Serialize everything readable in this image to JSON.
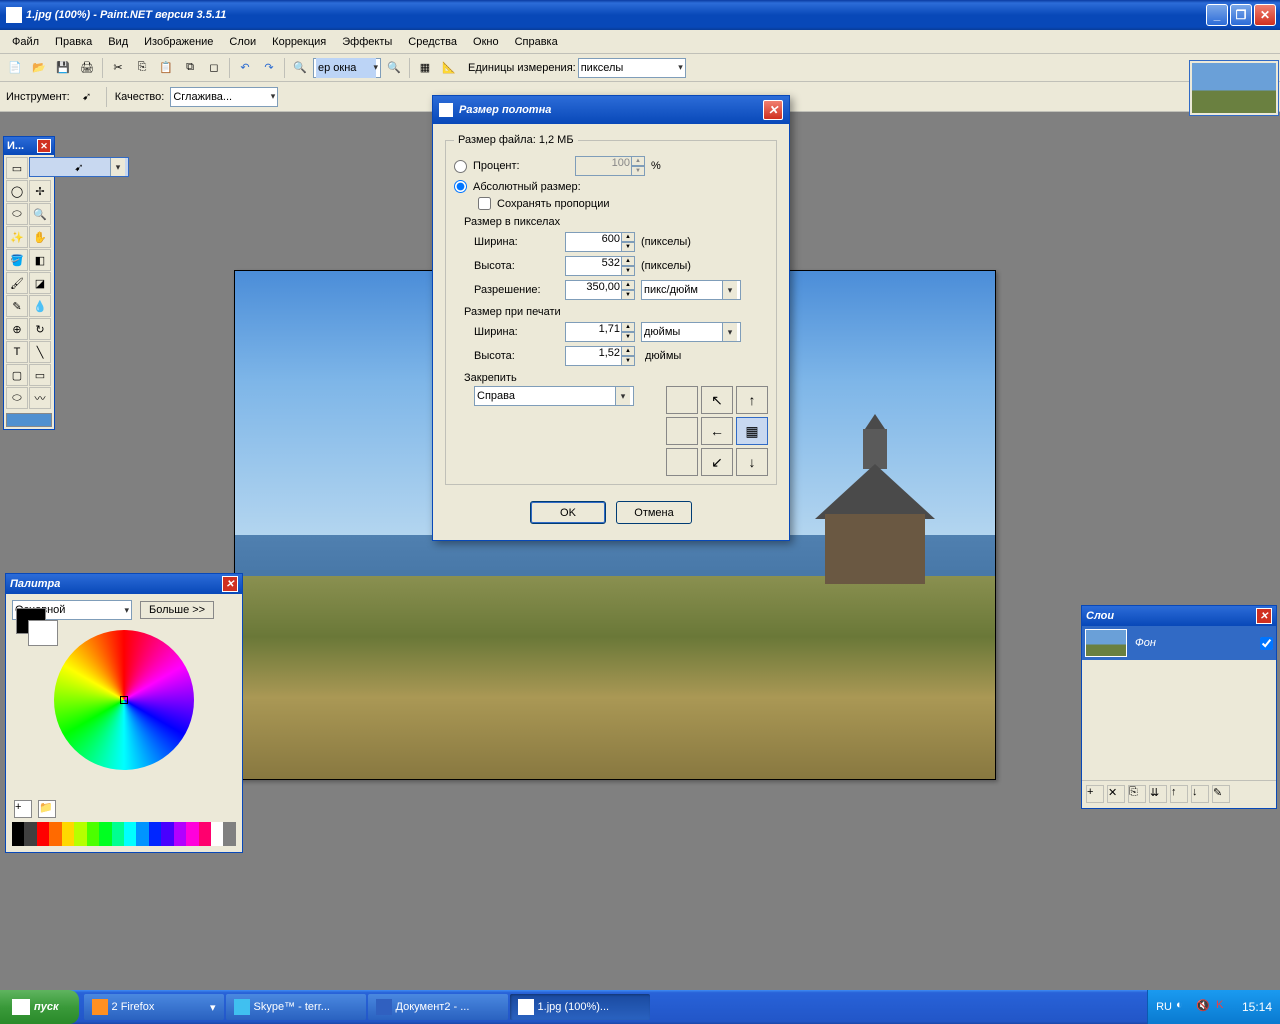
{
  "window": {
    "title": "1.jpg (100%) - Paint.NET версия 3.5.11"
  },
  "menu": {
    "file": "Файл",
    "edit": "Правка",
    "view": "Вид",
    "image": "Изображение",
    "layers": "Слои",
    "adjust": "Коррекция",
    "effects": "Эффекты",
    "tools": "Средства",
    "window": "Окно",
    "help": "Справка"
  },
  "toolbar": {
    "zoom": "ер окна",
    "units_label": "Единицы измерения:",
    "units": "пикселы"
  },
  "toolopts": {
    "instrument": "Инструмент:",
    "quality": "Качество:",
    "aa": "Сглажива..."
  },
  "toolpal": {
    "title": "И..."
  },
  "colorpal": {
    "title": "Палитра",
    "primary": "Основной",
    "more": "Больше >>",
    "colors": [
      "#000000",
      "#404040",
      "#ff0000",
      "#ff6a00",
      "#ffd800",
      "#b6ff00",
      "#4cff00",
      "#00ff21",
      "#00ff90",
      "#00ffff",
      "#0094ff",
      "#0026ff",
      "#4800ff",
      "#b200ff",
      "#ff00dc",
      "#ff006e",
      "#ffffff",
      "#808080"
    ]
  },
  "layers": {
    "title": "Слои",
    "bg": "Фон"
  },
  "dialog": {
    "title": "Размер полотна",
    "filesize_label": "Размер файла: 1,2 МБ",
    "percent": "Процент:",
    "percent_val": "100",
    "pct": "%",
    "absolute": "Абсолютный размер:",
    "keep": "Сохранять пропорции",
    "pxsize": "Размер в пикселах",
    "width": "Ширина:",
    "width_val": "600",
    "px_u": "(пикселы)",
    "height": "Высота:",
    "height_val": "532",
    "res": "Разрешение:",
    "res_val": "350,00",
    "res_u": "пикс/дюйм",
    "printsize": "Размер при печати",
    "pwidth_val": "1,71",
    "pheight_val": "1,52",
    "inch": "дюймы",
    "anchor": "Закрепить",
    "anchor_sel": "Справа",
    "ok": "OK",
    "cancel": "Отмена"
  },
  "taskbar": {
    "start": "пуск",
    "tasks": [
      {
        "label": "2 Firefox",
        "icon": "#ff9020"
      },
      {
        "label": "Skype™ - terr...",
        "icon": "#40c0f0"
      },
      {
        "label": "Документ2 - ...",
        "icon": "#3060c0"
      },
      {
        "label": "1.jpg (100%)...",
        "icon": "#ffffff"
      }
    ],
    "lang": "RU",
    "time": "15:14"
  }
}
